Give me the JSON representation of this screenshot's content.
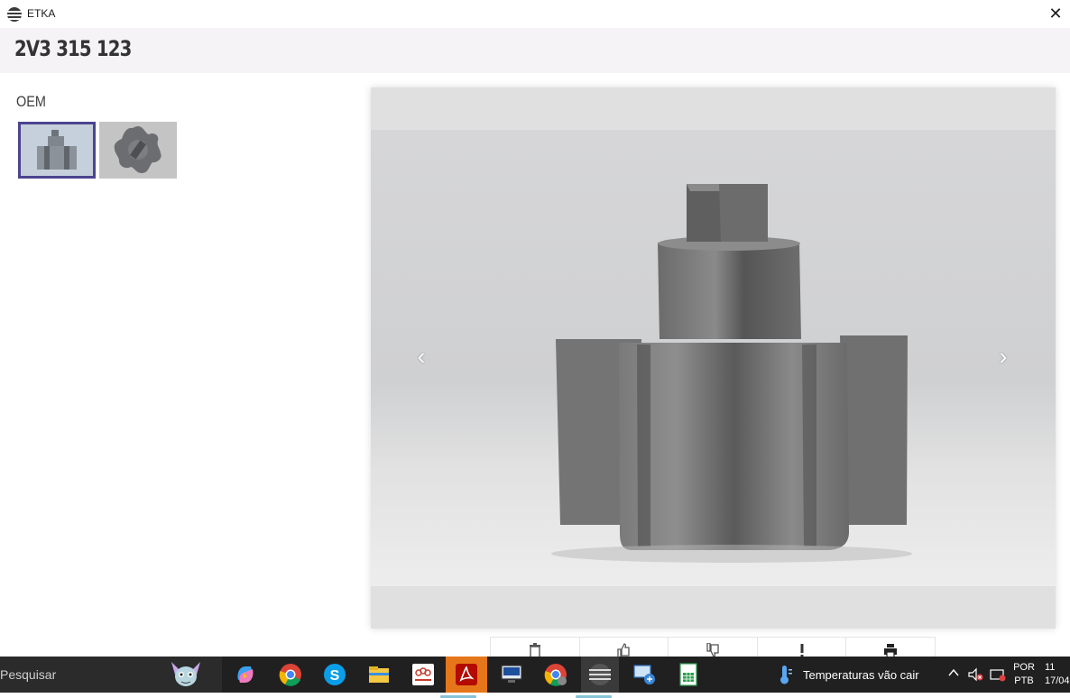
{
  "window": {
    "title": "ETKA",
    "close_glyph": "✕"
  },
  "header": {
    "part_number": "2V3 315 123"
  },
  "left_panel": {
    "section_label": "OEM",
    "thumbnails": [
      {
        "name": "thumbnail-1",
        "selected": true
      },
      {
        "name": "thumbnail-2",
        "selected": false
      }
    ]
  },
  "viewer": {
    "prev_glyph": "‹",
    "next_glyph": "›"
  },
  "actions": [
    {
      "icon": "trash-icon"
    },
    {
      "icon": "thumbs-up-icon"
    },
    {
      "icon": "thumbs-down-icon"
    },
    {
      "icon": "exclamation-icon"
    },
    {
      "icon": "printer-icon"
    }
  ],
  "taskbar": {
    "search_placeholder": "Pesquisar",
    "weather_text": "Temperaturas vão cair",
    "lang_line1": "POR",
    "lang_line2": "PTB",
    "clock_time": "11",
    "clock_date": "17/04",
    "apps": [
      "copilot-icon",
      "chrome-icon",
      "skype-icon",
      "file-explorer-icon",
      "teams-icon",
      "acrobat-icon",
      "remote-desktop-icon",
      "chrome-profile-icon",
      "etka-icon",
      "network-app-icon",
      "spreadsheet-icon"
    ],
    "accent": "#86c3d6"
  },
  "colors": {
    "selected_border": "#4b4590",
    "header_bg": "#f5f3f6",
    "taskbar_bg": "#202020"
  }
}
